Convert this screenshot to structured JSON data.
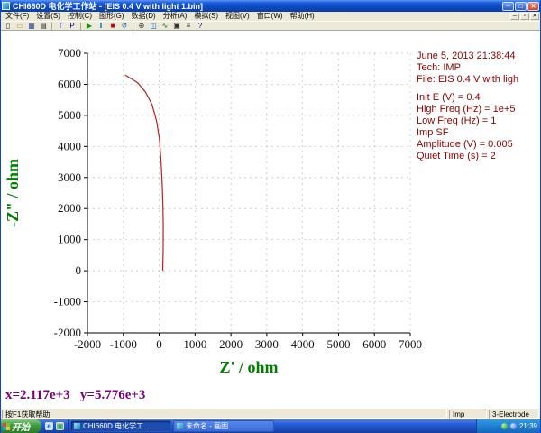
{
  "window": {
    "title": "CHI660D 电化学工作站 - [EIS 0.4 V with light 1.bin]",
    "controls": {
      "minimize": "─",
      "maximize": "□",
      "close": "✕"
    },
    "mdi_controls": {
      "minimize": "─",
      "restore": "▫",
      "close": "✕"
    }
  },
  "menu": {
    "items": [
      "文件(F)",
      "设置(S)",
      "控制(C)",
      "图形(G)",
      "数据(D)",
      "分析(A)",
      "模拟(S)",
      "视图(V)",
      "窗口(W)",
      "帮助(H)"
    ]
  },
  "toolbar": {
    "icons": [
      {
        "name": "new-file-icon",
        "glyph": "▯",
        "color": "#333333"
      },
      {
        "name": "open-file-icon",
        "glyph": "▭",
        "color": "#b8860b"
      },
      {
        "name": "save-icon",
        "glyph": "▦",
        "color": "#334d99"
      },
      {
        "name": "print-icon",
        "glyph": "▤",
        "color": "#333333"
      },
      {
        "name": "technique-icon",
        "glyph": "T",
        "color": "#000080"
      },
      {
        "name": "parameters-icon",
        "glyph": "P",
        "color": "#000080"
      },
      {
        "name": "run-icon",
        "glyph": "▶",
        "color": "#009900"
      },
      {
        "name": "pause-icon",
        "glyph": "‖",
        "color": "#0066cc"
      },
      {
        "name": "stop-icon",
        "glyph": "■",
        "color": "#cc0000"
      },
      {
        "name": "reverse-icon",
        "glyph": "↺",
        "color": "#0066cc"
      },
      {
        "name": "zoom-icon",
        "glyph": "⊕",
        "color": "#333333"
      },
      {
        "name": "overlay-icon",
        "glyph": "◫",
        "color": "#0066cc"
      },
      {
        "name": "smooth-icon",
        "glyph": "∿",
        "color": "#007700"
      },
      {
        "name": "copy-icon",
        "glyph": "▣",
        "color": "#333333"
      },
      {
        "name": "data-list-icon",
        "glyph": "≡",
        "color": "#333333"
      },
      {
        "name": "help-icon",
        "glyph": "?",
        "color": "#000080"
      }
    ]
  },
  "chart_data": {
    "type": "line",
    "title": "",
    "xlabel": "Z' / ohm",
    "ylabel": "-Z\" / ohm",
    "xlim": [
      -2000,
      7000
    ],
    "ylim": [
      -2000,
      7000
    ],
    "xticks": [
      -2000,
      -1000,
      0,
      1000,
      2000,
      3000,
      4000,
      5000,
      6000,
      7000
    ],
    "yticks": [
      -2000,
      -1000,
      0,
      1000,
      2000,
      3000,
      4000,
      5000,
      6000,
      7000
    ],
    "grid": true,
    "legend": "none",
    "series": [
      {
        "name": "EIS 0.4 V with light",
        "color": "#b22222",
        "points": [
          [
            100,
            0
          ],
          [
            112,
            700
          ],
          [
            115,
            1400
          ],
          [
            105,
            2100
          ],
          [
            85,
            2800
          ],
          [
            55,
            3500
          ],
          [
            10,
            4200
          ],
          [
            -70,
            4800
          ],
          [
            -200,
            5350
          ],
          [
            -380,
            5750
          ],
          [
            -600,
            6050
          ],
          [
            -950,
            6300
          ]
        ]
      }
    ]
  },
  "info_panel": {
    "color": "#8b0000",
    "lines": [
      "June 5, 2013   21:38:44",
      "Tech: IMP",
      "File: EIS 0.4 V with ligh",
      "",
      "Init E (V) = 0.4",
      "High Freq (Hz) = 1e+5",
      "Low Freq (Hz) = 1",
      "Imp SF",
      "Amplitude (V) = 0.005",
      "Quiet Time (s) = 2"
    ]
  },
  "readout": {
    "text": "x=2.117e+3   y=5.776e+3"
  },
  "statusbar": {
    "help_text": "按F1获取帮助",
    "field1": "Imp",
    "field2": "3-Electrode"
  },
  "taskbar": {
    "start_label": "开始",
    "tasks": [
      {
        "label": "CHI660D 电化学工...",
        "active": true
      },
      {
        "label": "未命名 - 画图",
        "active": false
      }
    ],
    "tray_time": "21:39"
  }
}
